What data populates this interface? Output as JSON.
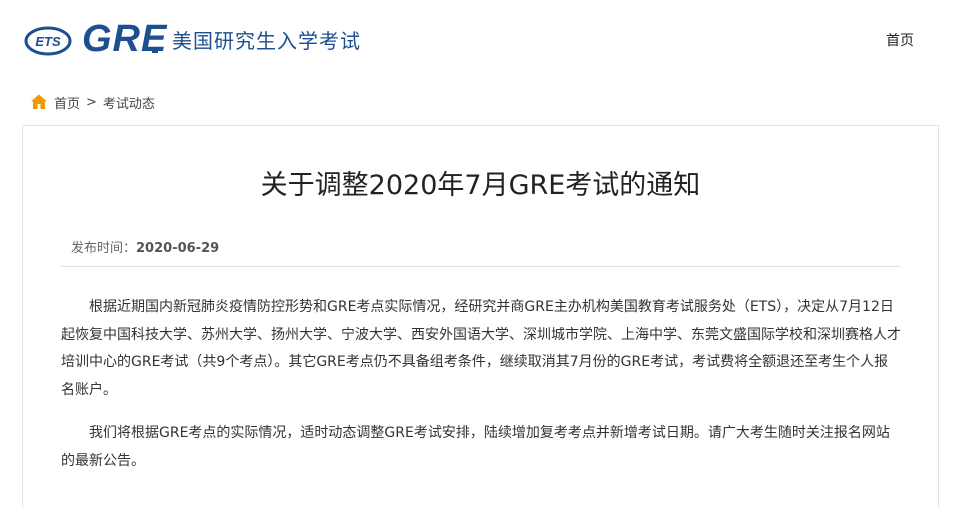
{
  "header": {
    "ets_logo_text": "ETS",
    "gre_logo_text": "GRE",
    "subtitle": "美国研究生入学考试",
    "nav_home": "首页"
  },
  "breadcrumb": {
    "home": "首页",
    "separator": ">",
    "current": "考试动态"
  },
  "article": {
    "title": "关于调整2020年7月GRE考试的通知",
    "publish_label": "发布时间：",
    "publish_date": "2020-06-29",
    "paragraphs": [
      "根据近期国内新冠肺炎疫情防控形势和GRE考点实际情况，经研究并商GRE主办机构美国教育考试服务处（ETS），决定从7月12日起恢复中国科技大学、苏州大学、扬州大学、宁波大学、西安外国语大学、深圳城市学院、上海中学、东莞文盛国际学校和深圳赛格人才培训中心的GRE考试（共9个考点）。其它GRE考点仍不具备组考条件，继续取消其7月份的GRE考试，考试费将全额退还至考生个人报名账户。",
      "我们将根据GRE考点的实际情况，适时动态调整GRE考试安排，陆续增加复考考点并新增考试日期。请广大考生随时关注报名网站的最新公告。"
    ]
  },
  "colors": {
    "brand_blue": "#1d4f91",
    "home_icon": "#f39800"
  }
}
